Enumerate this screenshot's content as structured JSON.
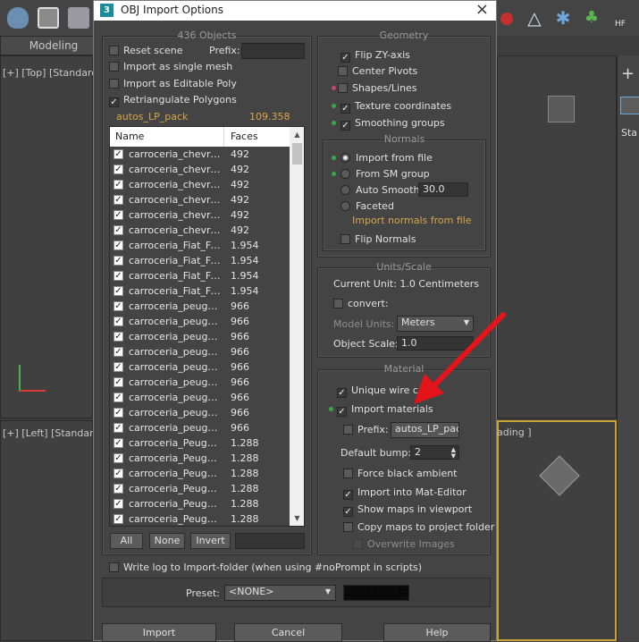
{
  "background": {
    "tab_label": "Modeling",
    "viewport_top_label": "[+] [Top] [Standard",
    "viewport_left_label": "[+] [Left] [Standard",
    "viewport_persp_label": "ading ]",
    "panel_label": "Sta"
  },
  "dialog": {
    "title": "OBJ Import Options",
    "objects": {
      "count_title": "436 Objects",
      "reset_scene": "Reset scene",
      "prefix_label": "Prefix:",
      "prefix_value": "",
      "import_single_mesh": "Import as single mesh",
      "import_editable_poly": "Import as Editable Poly",
      "retriangulate": "Retriangulate Polygons",
      "file_name": "autos_LP_pack",
      "file_size": "109.358",
      "col_name": "Name",
      "col_faces": "Faces",
      "rows": [
        {
          "name": "carroceria_chevrolet",
          "faces": "492"
        },
        {
          "name": "carroceria_chevrolet",
          "faces": "492"
        },
        {
          "name": "carroceria_chevrolet",
          "faces": "492"
        },
        {
          "name": "carroceria_chevrolet",
          "faces": "492"
        },
        {
          "name": "carroceria_chevrolet",
          "faces": "492"
        },
        {
          "name": "carroceria_chevrolet",
          "faces": "492"
        },
        {
          "name": "carroceria_Fiat_Fiorino",
          "faces": "1.954"
        },
        {
          "name": "carroceria_Fiat_Fiorino",
          "faces": "1.954"
        },
        {
          "name": "carroceria_Fiat_Fiorino",
          "faces": "1.954"
        },
        {
          "name": "carroceria_Fiat_Fiorino",
          "faces": "1.954"
        },
        {
          "name": "carroceria_peugeot",
          "faces": "966"
        },
        {
          "name": "carroceria_peugeot",
          "faces": "966"
        },
        {
          "name": "carroceria_peugeot",
          "faces": "966"
        },
        {
          "name": "carroceria_peugeot",
          "faces": "966"
        },
        {
          "name": "carroceria_peugeot",
          "faces": "966"
        },
        {
          "name": "carroceria_peugeot",
          "faces": "966"
        },
        {
          "name": "carroceria_peugeot",
          "faces": "966"
        },
        {
          "name": "carroceria_peugeot",
          "faces": "966"
        },
        {
          "name": "carroceria_peugeot",
          "faces": "966"
        },
        {
          "name": "carroceria_Peugeot",
          "faces": "1.288"
        },
        {
          "name": "carroceria_Peugeot",
          "faces": "1.288"
        },
        {
          "name": "carroceria_Peugeot",
          "faces": "1.288"
        },
        {
          "name": "carroceria_Peugeot",
          "faces": "1.288"
        },
        {
          "name": "carroceria_Peugeot",
          "faces": "1.288"
        },
        {
          "name": "carroceria_Peugeot",
          "faces": "1.288"
        }
      ],
      "btn_all": "All",
      "btn_none": "None",
      "btn_invert": "Invert"
    },
    "geometry": {
      "title": "Geometry",
      "flip_zy": "Flip ZY-axis",
      "center_pivots": "Center Pivots",
      "shapes_lines": "Shapes/Lines",
      "texture_coords": "Texture coordinates",
      "smoothing_groups": "Smoothing groups",
      "normals_title": "Normals",
      "import_from_file": "Import from file",
      "from_sm_group": "From SM group",
      "auto_smooth": "Auto Smooth:",
      "auto_smooth_value": "30.0",
      "faceted": "Faceted",
      "import_normals_note": "Import normals from file",
      "flip_normals": "Flip Normals"
    },
    "units": {
      "title": "Units/Scale",
      "current_unit": "Current Unit:  1.0 Centimeters",
      "convert": "convert:",
      "model_units_label": "Model Units:",
      "model_units_value": "Meters",
      "object_scale_label": "Object Scale:",
      "object_scale_value": "1.0"
    },
    "material": {
      "title": "Material",
      "unique_wire": "Unique wire co",
      "import_materials": "Import materials",
      "prefix_label": "Prefix:",
      "prefix_value": "autos_LP_pack",
      "default_bump_label": "Default bump:",
      "default_bump_value": "2",
      "force_black_ambient": "Force black ambient",
      "import_mat_editor": "Import into Mat-Editor",
      "show_maps": "Show maps in viewport",
      "copy_maps": "Copy maps to project folder",
      "overwrite_images": "Overwrite Images"
    },
    "write_log": "Write log to Import-folder (when using #noPrompt in scripts)",
    "preset_label": "Preset:",
    "preset_value": "<NONE>",
    "btn_import": "Import",
    "btn_cancel": "Cancel",
    "btn_help": "Help"
  },
  "colors": {
    "arrow": "#e5141b",
    "orange_text": "#d8a64a",
    "green_dot": "#3aa54a"
  }
}
